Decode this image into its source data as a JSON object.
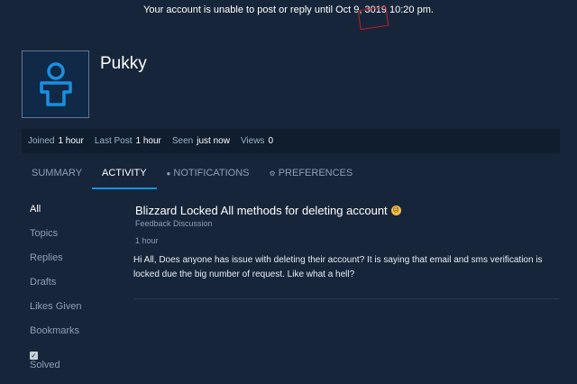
{
  "banner": {
    "text": "Your account is unable to post or reply until Oct 9, 3019 10:20 pm."
  },
  "profile": {
    "username": "Pukky",
    "avatar_icon": "user-silhouette-icon",
    "accent": "#1b8fe0"
  },
  "stats": [
    {
      "label": "Joined",
      "value": "1 hour"
    },
    {
      "label": "Last Post",
      "value": "1 hour"
    },
    {
      "label": "Seen",
      "value": "just now"
    },
    {
      "label": "Views",
      "value": "0"
    }
  ],
  "tabs": [
    {
      "label": "SUMMARY",
      "icon": ""
    },
    {
      "label": "ACTIVITY",
      "icon": ""
    },
    {
      "label": "NOTIFICATIONS",
      "icon": "speech-bubble-icon"
    },
    {
      "label": "PREFERENCES",
      "icon": "gear-icon"
    }
  ],
  "active_tab": "ACTIVITY",
  "sidebar": {
    "items": [
      "All",
      "Topics",
      "Replies",
      "Drafts",
      "Likes Given",
      "Bookmarks"
    ],
    "solved_label": "Solved"
  },
  "post": {
    "title": "Blizzard Locked All methods for deleting account",
    "title_emoji": "sad-face-icon",
    "category": "Feedback Discussion",
    "time": "1 hour",
    "body": "Hi All, Does anyone has issue with deleting their account? It is saying that email and sms verification is locked due the big number of request. Like what a hell?"
  }
}
